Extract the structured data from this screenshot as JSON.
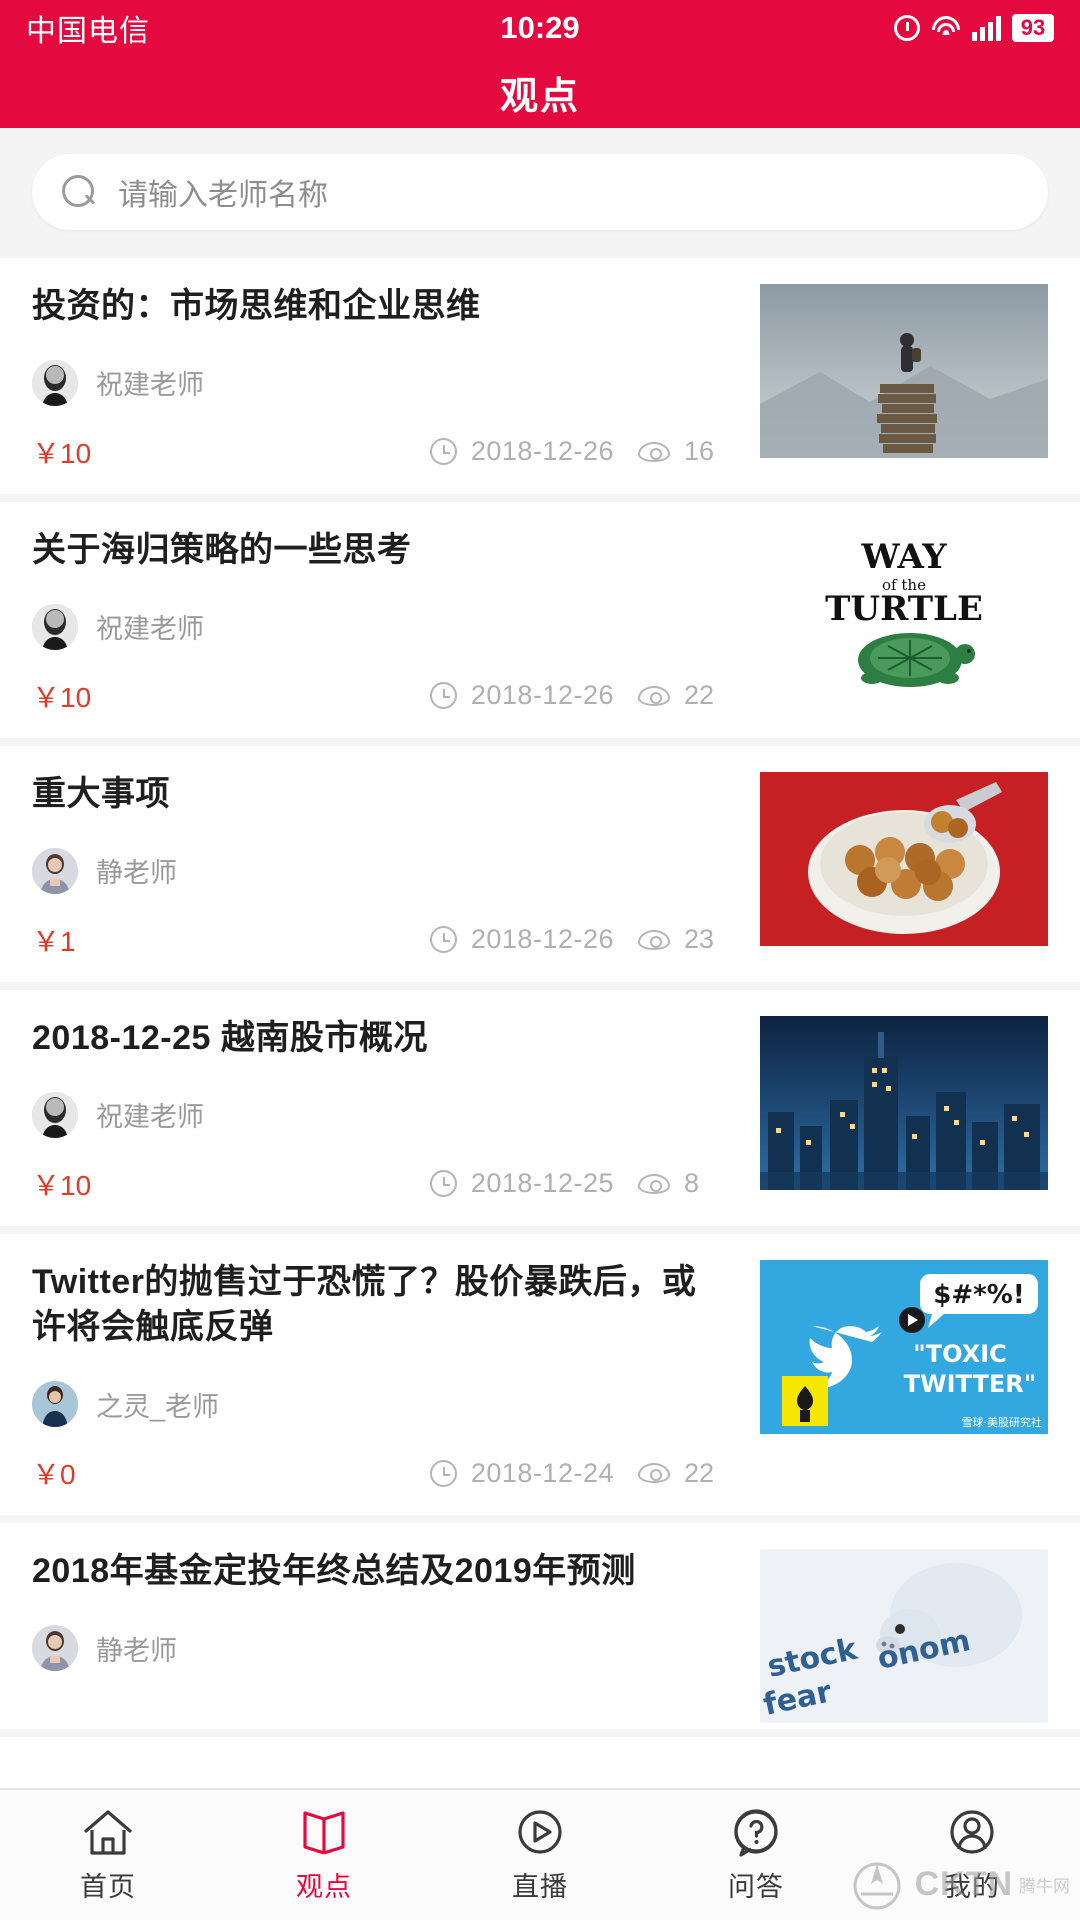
{
  "status_bar": {
    "carrier": "中国电信",
    "time": "10:29",
    "battery": "93",
    "icons": [
      "alarm-icon",
      "wifi-icon",
      "signal-icon",
      "battery-icon"
    ]
  },
  "header": {
    "title": "观点",
    "background_color": "#e4093f"
  },
  "search": {
    "placeholder": "请输入老师名称",
    "icon": "search-icon",
    "value": ""
  },
  "colors": {
    "brand": "#e4093f",
    "price": "#e03a28",
    "meta_text": "#b0b0b0",
    "title_text": "#1f1f1f"
  },
  "list": {
    "items": [
      {
        "title": "投资的：市场思维和企业思维",
        "author": "祝建老师",
        "price": "￥10",
        "date": "2018-12-26",
        "views": "16",
        "thumb": "man-standing-on-books"
      },
      {
        "title": "关于海归策略的一些思考",
        "author": "祝建老师",
        "price": "￥10",
        "date": "2018-12-26",
        "views": "22",
        "thumb": "way-of-the-turtle-book"
      },
      {
        "title": "重大事项",
        "author": "静老师",
        "price": "￥1",
        "date": "2018-12-26",
        "views": "23",
        "thumb": "bowl-of-coins"
      },
      {
        "title": "2018-12-25 越南股市概况",
        "author": "祝建老师",
        "price": "￥10",
        "date": "2018-12-25",
        "views": "8",
        "thumb": "city-skyline-night"
      },
      {
        "title": "Twitter的抛售过于恐慌了？股价暴跌后，或许将会触底反弹",
        "author": "之灵_老师",
        "price": "￥0",
        "date": "2018-12-24",
        "views": "22",
        "thumb": "toxic-twitter-banner"
      },
      {
        "title": "2018年基金定投年终总结及2019年预测",
        "author": "静老师",
        "price": "",
        "date": "",
        "views": "",
        "thumb": "piggy-bank-stock"
      }
    ]
  },
  "tabbar": {
    "items": [
      {
        "label": "首页",
        "icon": "home-icon",
        "active": false
      },
      {
        "label": "观点",
        "icon": "book-icon",
        "active": true
      },
      {
        "label": "直播",
        "icon": "play-circle-icon",
        "active": false
      },
      {
        "label": "问答",
        "icon": "question-bubble-icon",
        "active": false
      },
      {
        "label": "我的",
        "icon": "user-icon",
        "active": false
      }
    ]
  },
  "watermark": {
    "text": "CKTN",
    "sub": "腾牛网"
  }
}
